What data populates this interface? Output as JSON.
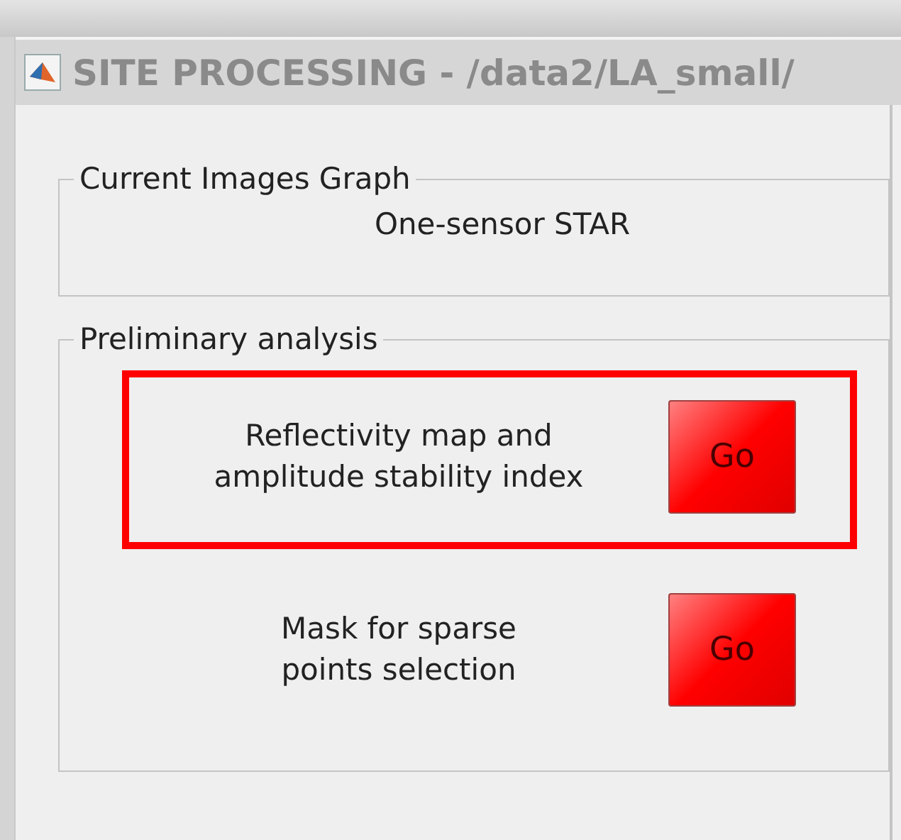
{
  "window": {
    "title": "SITE PROCESSING - /data2/LA_small/"
  },
  "panels": [
    {
      "title": "Current Images Graph",
      "kind": "info",
      "text": "One-sensor STAR"
    },
    {
      "title": "Preliminary analysis",
      "kind": "actions",
      "actions": [
        {
          "label": "Reflectivity map and\namplitude stability index",
          "button": "Go",
          "highlighted": true
        },
        {
          "label": "Mask for sparse\npoints selection",
          "button": "Go",
          "highlighted": false
        }
      ]
    }
  ]
}
